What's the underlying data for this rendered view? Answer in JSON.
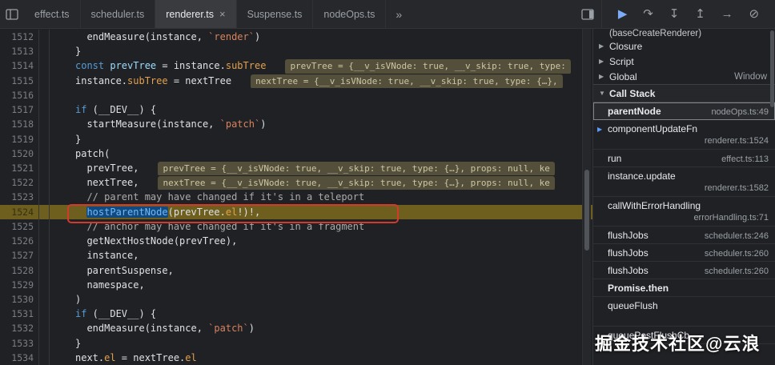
{
  "tabbar": {
    "tabs": [
      {
        "label": "effect.ts",
        "active": false
      },
      {
        "label": "scheduler.ts",
        "active": false
      },
      {
        "label": "renderer.ts",
        "active": true
      },
      {
        "label": "Suspense.ts",
        "active": false
      },
      {
        "label": "nodeOps.ts",
        "active": false
      }
    ],
    "close_glyph": "×",
    "more_glyph": "»",
    "controls": [
      {
        "name": "resume",
        "glyph": "▶",
        "accent": true
      },
      {
        "name": "step-over",
        "glyph": "↷",
        "accent": false
      },
      {
        "name": "step-into",
        "glyph": "↧",
        "accent": false
      },
      {
        "name": "step-out",
        "glyph": "↥",
        "accent": false
      },
      {
        "name": "step",
        "glyph": "→",
        "accent": false
      },
      {
        "name": "deactivate-breakpoints",
        "glyph": "⊘",
        "accent": false
      }
    ]
  },
  "editor": {
    "lines": [
      {
        "num": 1512,
        "tokens": [
          [
            "  endMeasure(instance, ",
            "tx"
          ],
          [
            "`render`",
            "str"
          ],
          [
            ")",
            "tx"
          ]
        ]
      },
      {
        "num": 1513,
        "tokens": [
          [
            "}",
            "tx"
          ]
        ]
      },
      {
        "num": 1514,
        "tokens": [
          [
            "const ",
            "kw"
          ],
          [
            "prevTree",
            "def"
          ],
          [
            " = instance.",
            "tx"
          ],
          [
            "subTree",
            "prop"
          ]
        ],
        "badge": "prevTree = {__v_isVNode: true, __v_skip: true, type:"
      },
      {
        "num": 1515,
        "tokens": [
          [
            "instance.",
            "tx"
          ],
          [
            "subTree",
            "prop"
          ],
          [
            " = nextTree",
            "tx"
          ]
        ],
        "badge": "nextTree = {__v_isVNode: true, __v_skip: true, type: {…},"
      },
      {
        "num": 1516,
        "tokens": []
      },
      {
        "num": 1517,
        "tokens": [
          [
            "if",
            "kw"
          ],
          [
            " (__DEV__) {",
            "tx"
          ]
        ]
      },
      {
        "num": 1518,
        "tokens": [
          [
            "  startMeasure(instance, ",
            "tx"
          ],
          [
            "`patch`",
            "str"
          ],
          [
            ")",
            "tx"
          ]
        ]
      },
      {
        "num": 1519,
        "tokens": [
          [
            "}",
            "tx"
          ]
        ]
      },
      {
        "num": 1520,
        "tokens": [
          [
            "patch(",
            "tx"
          ]
        ]
      },
      {
        "num": 1521,
        "tokens": [
          [
            "  prevTree,",
            "tx"
          ]
        ],
        "badge": "prevTree = {__v_isVNode: true, __v_skip: true, type: {…}, props: null, ke"
      },
      {
        "num": 1522,
        "tokens": [
          [
            "  nextTree,",
            "tx"
          ]
        ],
        "badge": "nextTree = {__v_isVNode: true, __v_skip: true, type: {…}, props: null, ke"
      },
      {
        "num": 1523,
        "tokens": [
          [
            "  // parent may have changed if it's in a teleport",
            "cm"
          ]
        ]
      },
      {
        "num": 1524,
        "exec": true,
        "tokens": [
          [
            "  ",
            "tx"
          ],
          [
            "hostParentNode",
            "hl"
          ],
          [
            "(prevTree.",
            "tx"
          ],
          [
            "el",
            "prop"
          ],
          [
            "!)!,",
            "tx"
          ]
        ]
      },
      {
        "num": 1525,
        "tokens": [
          [
            "  // anchor may have changed if it's in a fragment",
            "cm"
          ]
        ]
      },
      {
        "num": 1526,
        "tokens": [
          [
            "  getNextHostNode(prevTree),",
            "tx"
          ]
        ]
      },
      {
        "num": 1527,
        "tokens": [
          [
            "  instance,",
            "tx"
          ]
        ]
      },
      {
        "num": 1528,
        "tokens": [
          [
            "  parentSuspense,",
            "tx"
          ]
        ]
      },
      {
        "num": 1529,
        "tokens": [
          [
            "  namespace,",
            "tx"
          ]
        ]
      },
      {
        "num": 1530,
        "tokens": [
          [
            ")",
            "tx"
          ]
        ]
      },
      {
        "num": 1531,
        "tokens": [
          [
            "if",
            "kw"
          ],
          [
            " (__DEV__) {",
            "tx"
          ]
        ]
      },
      {
        "num": 1532,
        "tokens": [
          [
            "  endMeasure(instance, ",
            "tx"
          ],
          [
            "`patch`",
            "str"
          ],
          [
            ")",
            "tx"
          ]
        ]
      },
      {
        "num": 1533,
        "tokens": [
          [
            "}",
            "tx"
          ]
        ]
      },
      {
        "num": 1534,
        "tokens": [
          [
            "next.",
            "tx"
          ],
          [
            "el",
            "prop"
          ],
          [
            " = nextTree.",
            "tx"
          ],
          [
            "el",
            "prop"
          ]
        ]
      }
    ]
  },
  "scope": {
    "partial": "(baseCreateRenderer)",
    "rows": [
      {
        "arrow": "▶",
        "label": "Closure",
        "right": ""
      },
      {
        "arrow": "▶",
        "label": "Script",
        "right": ""
      },
      {
        "arrow": "▶",
        "label": "Global",
        "right": "Window"
      }
    ]
  },
  "callstack": {
    "header": "Call Stack",
    "header_arrow": "▼",
    "marker_glyph": "▶",
    "frames": [
      {
        "name": "parentNode",
        "loc": "nodeOps.ts:49",
        "active": true
      },
      {
        "name": "componentUpdateFn",
        "loc": "renderer.ts:1524",
        "two_line": true,
        "marker": true
      },
      {
        "name": "run",
        "loc": "effect.ts:113"
      },
      {
        "name": "instance.update",
        "loc": "renderer.ts:1582",
        "two_line": true
      },
      {
        "name": "callWithErrorHandling",
        "loc": "errorHandling.ts:71",
        "two_line": true
      },
      {
        "name": "flushJobs",
        "loc": "scheduler.ts:246"
      },
      {
        "name": "flushJobs",
        "loc": "scheduler.ts:260"
      },
      {
        "name": "flushJobs",
        "loc": "scheduler.ts:260"
      },
      {
        "name": "Promise.then",
        "loc": "",
        "async": true
      },
      {
        "name": "queueFlush",
        "loc": "",
        "two_line": true
      },
      {
        "name": "queuePostFlushCb",
        "loc": ""
      }
    ]
  },
  "watermark": "掘金技术社区@云浪"
}
